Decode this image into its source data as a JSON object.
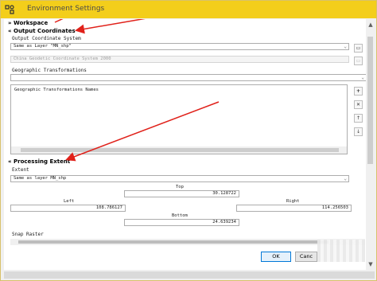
{
  "window": {
    "title": "Environment Settings"
  },
  "sections": {
    "workspace": {
      "label": "Workspace",
      "expander": "»"
    },
    "output_coordinates": {
      "label": "Output Coordinates",
      "expander": "«"
    },
    "processing_extent": {
      "label": "Processing Extent",
      "expander": "«"
    }
  },
  "output_coordinates": {
    "system_label": "Output Coordinate System",
    "system_value": "Same as Layer \"MN_shp\"",
    "disabled_value": "China Geodetic Coordinate System 2000",
    "geo_transform_label": "Geographic Transformations",
    "list_header": "Geographic Transformations Names"
  },
  "processing_extent": {
    "extent_label": "Extent",
    "extent_value": "Same as layer MN_shp",
    "top_label": "Top",
    "top_value": "30.128722",
    "left_label": "Left",
    "left_value": "108.786127",
    "right_label": "Right",
    "right_value": "114.256503",
    "bottom_label": "Bottom",
    "bottom_value": "24.639234",
    "snap_label": "Snap Raster"
  },
  "buttons": {
    "ok": "OK",
    "cancel": "Canc"
  },
  "side_icons": [
    "folder-icon",
    "plus-icon",
    "close-icon",
    "up-arrow-icon",
    "down-arrow-icon"
  ],
  "colors": {
    "titlebar": "#f3ce1b",
    "arrow": "#e0211a"
  }
}
